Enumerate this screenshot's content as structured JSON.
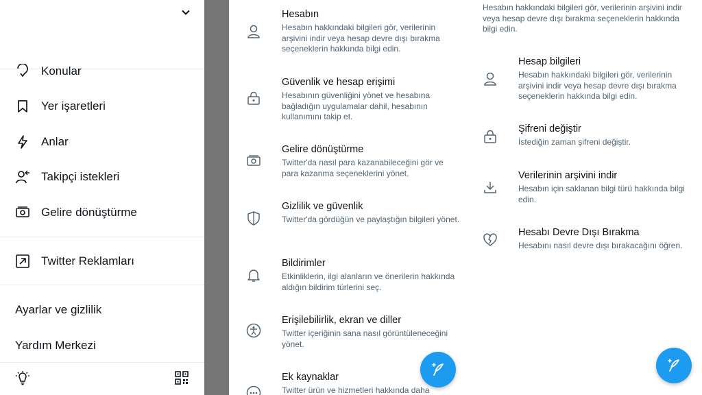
{
  "drawer": {
    "items": [
      {
        "label": "Konular",
        "icon": "topics-icon"
      },
      {
        "label": "Yer işaretleri",
        "icon": "bookmark-icon"
      },
      {
        "label": "Anlar",
        "icon": "lightning-icon"
      },
      {
        "label": "Takipçi istekleri",
        "icon": "follower-request-icon"
      },
      {
        "label": "Gelire dönüştürme",
        "icon": "money-icon"
      }
    ],
    "ads_label": "Twitter Reklamları",
    "settings_label": "Ayarlar ve gizlilik",
    "help_label": "Yardım Merkezi"
  },
  "settings": {
    "rows": [
      {
        "title": "Hesabın",
        "desc": "Hesabın hakkındaki bilgileri gör, verilerinin arşivini indir veya hesap devre dışı bırakma seçeneklerin hakkında bilgi edin.",
        "icon": "person-icon"
      },
      {
        "title": "Güvenlik ve hesap erişimi",
        "desc": "Hesabının güvenliğini yönet ve hesabına bağladığın uygulamalar dahil, hesabının kullanımını takip et.",
        "icon": "lock-icon"
      },
      {
        "title": "Gelire dönüştürme",
        "desc": "Twitter'da nasıl para kazanabileceğini gör ve para kazanma seçeneklerini yönet.",
        "icon": "money-icon"
      },
      {
        "title": "Gizlilik ve güvenlik",
        "desc": "Twitter'da gördüğün ve paylaştığın bilgileri yönet.",
        "icon": "shield-icon"
      },
      {
        "title": "Bildirimler",
        "desc": "Etkinliklerin, ilgi alanların ve önerilerin hakkında aldığın bildirim türlerini seç.",
        "icon": "bell-icon"
      },
      {
        "title": "Erişilebilirlik, ekran ve diller",
        "desc": "Twitter içeriğinin sana nasıl görüntüleneceğini yönet.",
        "icon": "accessibility-icon"
      },
      {
        "title": "Ek kaynaklar",
        "desc": "Twitter ürün ve hizmetleri hakkında daha",
        "icon": "more-icon"
      }
    ]
  },
  "account": {
    "intro": "Hesabın hakkındaki bilgileri gör, verilerinin arşivini indir veya hesap devre dışı bırakma seçeneklerin hakkında bilgi edin.",
    "rows": [
      {
        "title": "Hesap bilgileri",
        "desc": "Hesabın hakkındaki bilgileri gör, verilerinin arşivini indir veya hesap devre dışı bırakma seçeneklerin hakkında bilgi edin.",
        "icon": "person-icon"
      },
      {
        "title": "Şifreni değiştir",
        "desc": "İstediğin zaman şifreni değiştir.",
        "icon": "lock-icon"
      },
      {
        "title": "Verilerinin arşivini indir",
        "desc": "Hesabın için saklanan bilgi türü hakkında bilgi edin.",
        "icon": "download-icon"
      },
      {
        "title": "Hesabı Devre Dışı Bırakma",
        "desc": "Hesabını nasıl devre dışı bırakacağını öğren.",
        "icon": "broken-heart-icon"
      }
    ]
  },
  "colors": {
    "accent": "#1d9bf0",
    "text": "#0f1419",
    "secondary": "#536471",
    "overlay": "#767676"
  }
}
